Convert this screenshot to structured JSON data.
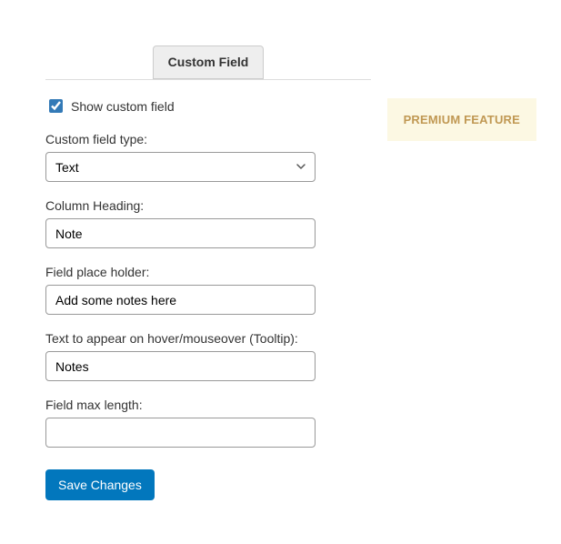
{
  "tab": {
    "label": "Custom Field"
  },
  "badge": {
    "text": "PREMIUM FEATURE"
  },
  "show_custom_field": {
    "label": "Show custom field",
    "checked": true
  },
  "custom_field_type": {
    "label": "Custom field type:",
    "value": "Text"
  },
  "column_heading": {
    "label": "Column Heading:",
    "value": "Note"
  },
  "placeholder_field": {
    "label": "Field place holder:",
    "value": "Add some notes here"
  },
  "tooltip_field": {
    "label": "Text to appear on hover/mouseover (Tooltip):",
    "value": "Notes"
  },
  "max_length": {
    "label": "Field max length:",
    "value": ""
  },
  "save_button": {
    "label": "Save Changes"
  }
}
